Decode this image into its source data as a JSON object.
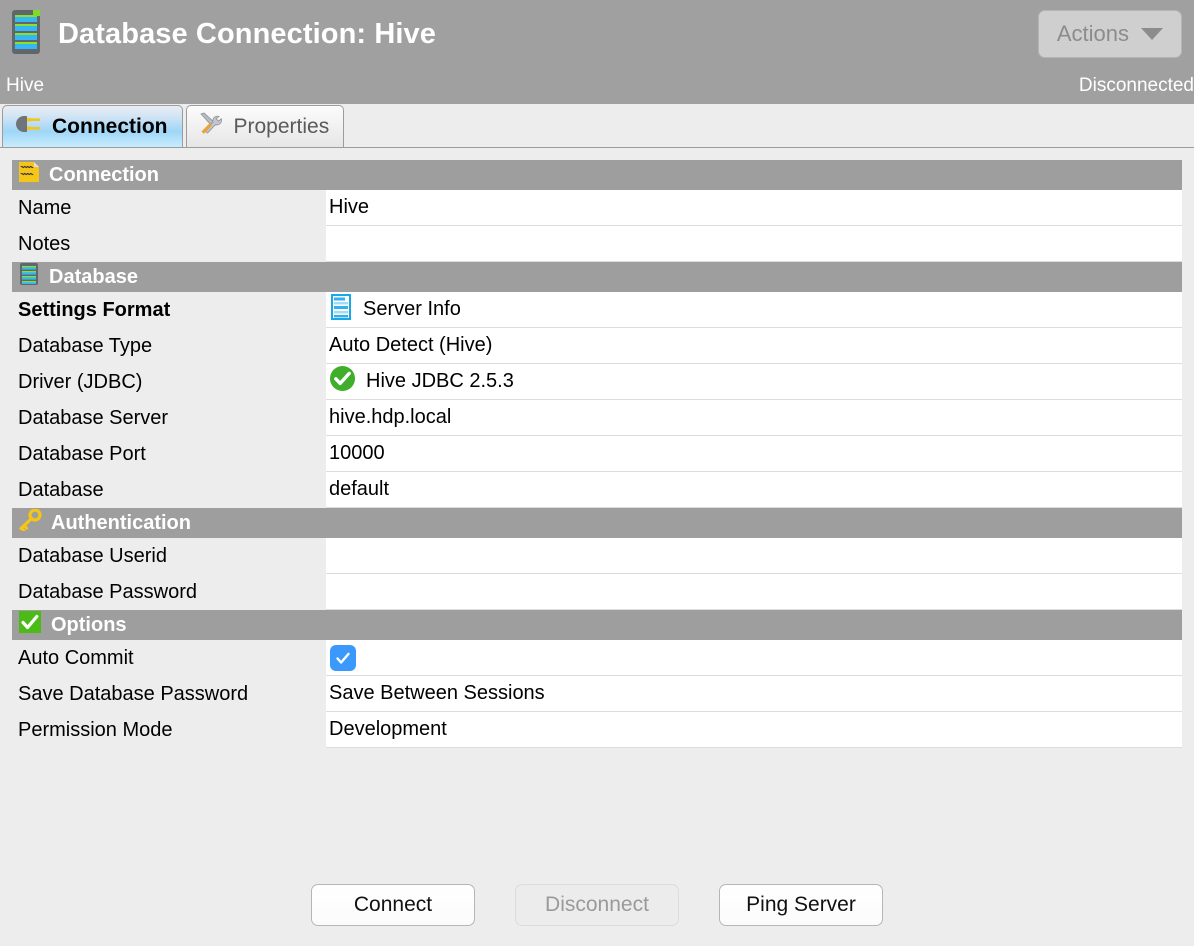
{
  "window": {
    "title": "Database Connection: Hive",
    "app_icon": "database-icon",
    "actions_button": {
      "label": "Actions",
      "icon": "chevron-down-icon",
      "enabled": false
    }
  },
  "status": {
    "connection_name": "Hive",
    "connection_state": "Disconnected"
  },
  "tabs": [
    {
      "label": "Connection",
      "icon": "plug-icon",
      "active": true
    },
    {
      "label": "Properties",
      "icon": "tools-icon",
      "active": false
    }
  ],
  "sections": [
    {
      "title": "Connection",
      "icon": "signal-document-icon",
      "rows": [
        {
          "label": "Name",
          "value": "Hive",
          "bold": false,
          "icon": null,
          "type": "text"
        },
        {
          "label": "Notes",
          "value": "",
          "bold": false,
          "icon": null,
          "type": "text"
        }
      ]
    },
    {
      "title": "Database",
      "icon": "database-icon",
      "rows": [
        {
          "label": "Settings Format",
          "value": "Server Info",
          "bold": true,
          "icon": "server-info-icon",
          "type": "text"
        },
        {
          "label": "Database Type",
          "value": "Auto Detect (Hive)",
          "bold": false,
          "icon": null,
          "type": "text"
        },
        {
          "label": "Driver (JDBC)",
          "value": "Hive JDBC 2.5.3",
          "bold": false,
          "icon": "green-check-circle-icon",
          "type": "text"
        },
        {
          "label": "Database Server",
          "value": "hive.hdp.local",
          "bold": false,
          "icon": null,
          "type": "text"
        },
        {
          "label": "Database Port",
          "value": "10000",
          "bold": false,
          "icon": null,
          "type": "text"
        },
        {
          "label": "Database",
          "value": "default",
          "bold": false,
          "icon": null,
          "type": "text"
        }
      ]
    },
    {
      "title": "Authentication",
      "icon": "key-icon",
      "rows": [
        {
          "label": "Database Userid",
          "value": "",
          "bold": false,
          "icon": null,
          "type": "text"
        },
        {
          "label": "Database Password",
          "value": "",
          "bold": false,
          "icon": null,
          "type": "password"
        }
      ]
    },
    {
      "title": "Options",
      "icon": "green-check-square-icon",
      "rows": [
        {
          "label": "Auto Commit",
          "value": "",
          "bold": false,
          "icon": null,
          "type": "checkbox",
          "checked": true
        },
        {
          "label": "Save Database Password",
          "value": "Save Between Sessions",
          "bold": false,
          "icon": null,
          "type": "text"
        },
        {
          "label": "Permission Mode",
          "value": "Development",
          "bold": false,
          "icon": null,
          "type": "text"
        }
      ]
    }
  ],
  "footer_buttons": [
    {
      "label": "Connect",
      "enabled": true
    },
    {
      "label": "Disconnect",
      "enabled": false
    },
    {
      "label": "Ping Server",
      "enabled": true
    }
  ],
  "colors": {
    "header_gray": "#a0a0a0",
    "section_gray": "#9e9e9e",
    "page_bg": "#ededed",
    "value_bg": "#ffffff",
    "accent_blue": "#3b99fc",
    "ok_green": "#3fae2a",
    "key_yellow": "#f5c518"
  }
}
